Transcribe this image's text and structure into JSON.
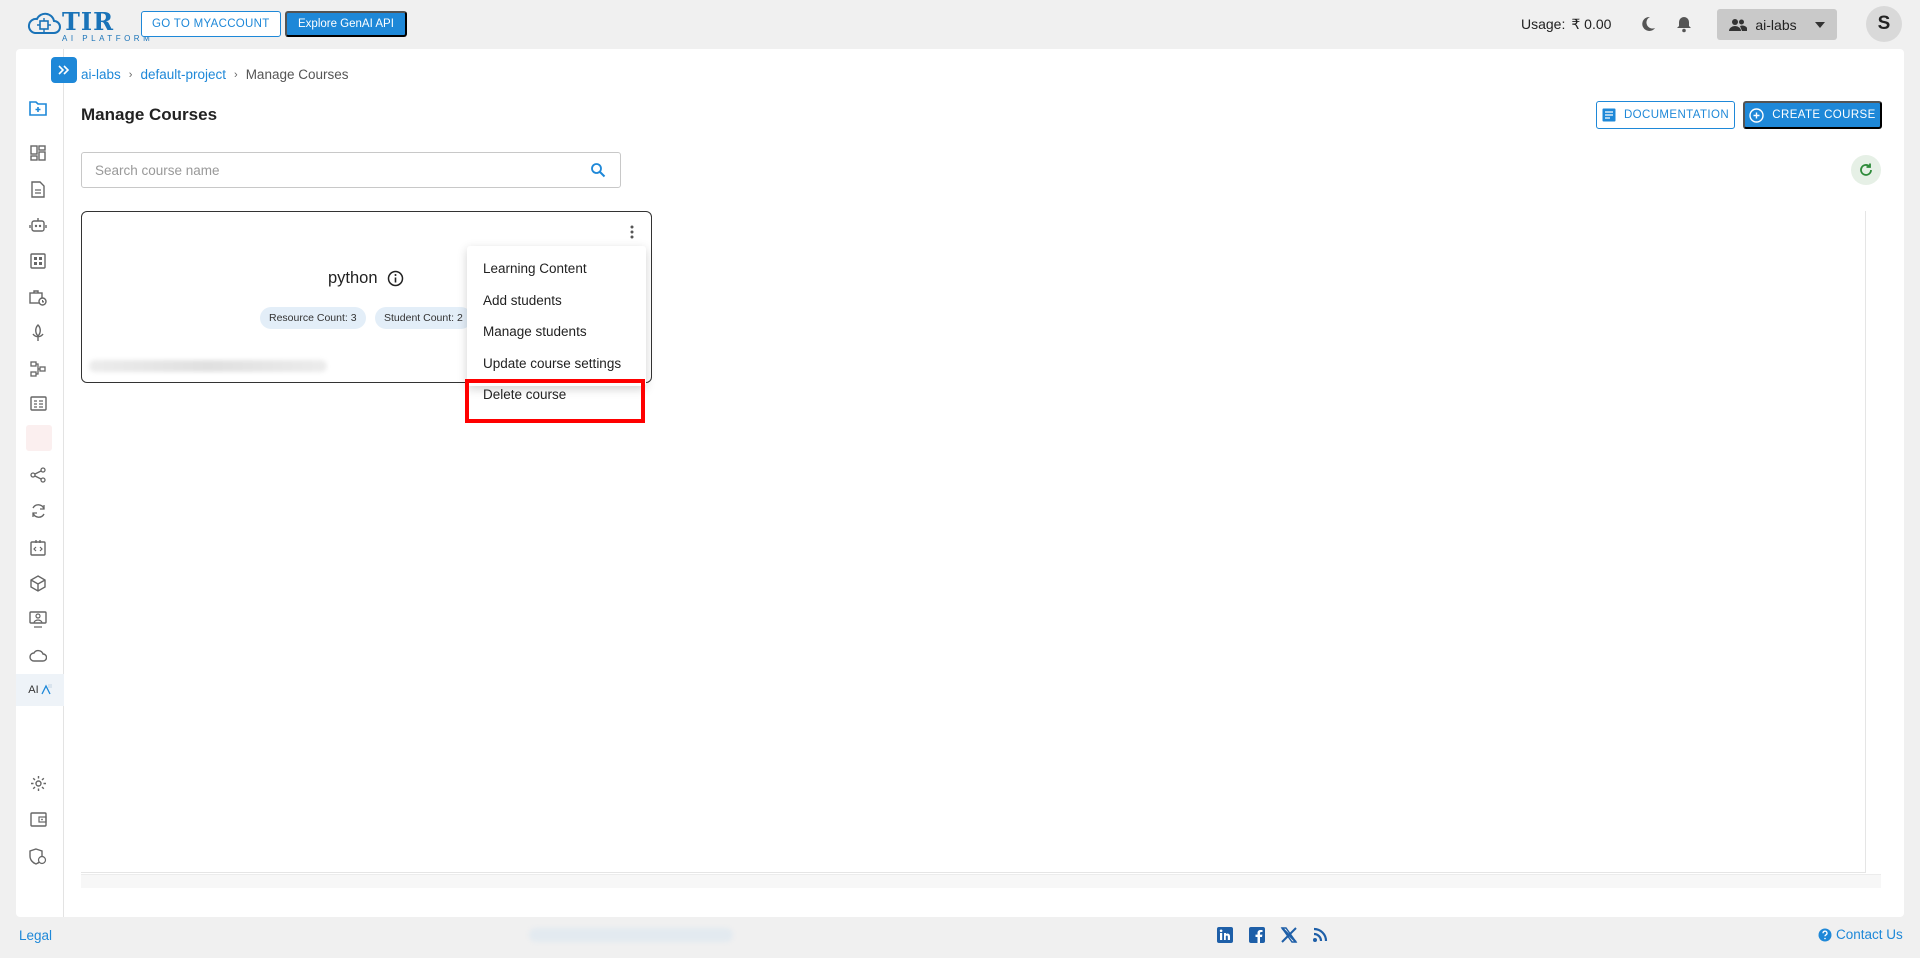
{
  "logo": {
    "title": "TIR",
    "subtitle": "AI PLATFORM"
  },
  "topbar": {
    "myaccount_label": "GO TO MYACCOUNT",
    "genai_label": "Explore GenAI API",
    "usage_label": "Usage:",
    "usage_value": "₹ 0.00",
    "team_label": "ai-labs",
    "avatar_initial": "S"
  },
  "sidebar": {
    "ai_label": "AI",
    "items": [
      "folder-add-icon",
      "dashboard-icon",
      "document-icon",
      "robot-icon",
      "apps-icon",
      "briefcase-clock-icon",
      "deploy-icon",
      "pipeline-icon",
      "dataset-icon",
      "blank",
      "network-icon",
      "sync-icon",
      "code-box-icon",
      "cube-icon",
      "monitor-user-icon",
      "cloud-icon",
      "ai-labs-icon",
      "settings-icon",
      "wallet-icon",
      "security-icon"
    ]
  },
  "breadcrumb": {
    "items": [
      "ai-labs",
      "default-project"
    ],
    "current": "Manage Courses"
  },
  "page": {
    "title": "Manage Courses",
    "documentation_label": "DOCUMENTATION",
    "create_label": "CREATE COURSE",
    "search_placeholder": "Search course name"
  },
  "course": {
    "name": "python",
    "resource_count": "Resource Count: 3",
    "student_count": "Student Count: 2"
  },
  "menu": {
    "items": [
      "Learning Content",
      "Add students",
      "Manage students",
      "Update course settings",
      "Delete course"
    ]
  },
  "footer": {
    "legal": "Legal",
    "contact": "Contact Us",
    "social": [
      "linkedin-icon",
      "facebook-icon",
      "x-icon",
      "rss-icon"
    ]
  },
  "colors": {
    "accent": "#1e88d8",
    "highlight": "#ff0000"
  }
}
